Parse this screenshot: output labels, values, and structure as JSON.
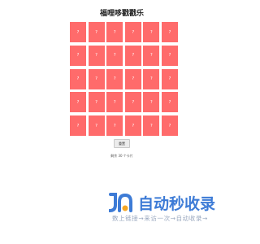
{
  "title": "福哩哆戳戳乐",
  "cards": [
    {
      "label": "?"
    },
    {
      "label": "?"
    },
    {
      "label": "?"
    },
    {
      "label": "?"
    },
    {
      "label": "?"
    },
    {
      "label": "?"
    },
    {
      "label": "?"
    },
    {
      "label": "?"
    },
    {
      "label": "?"
    },
    {
      "label": "?"
    },
    {
      "label": "?"
    },
    {
      "label": "?"
    },
    {
      "label": "?"
    },
    {
      "label": "?"
    },
    {
      "label": "?"
    },
    {
      "label": "?"
    },
    {
      "label": "?"
    },
    {
      "label": "?"
    },
    {
      "label": "?"
    },
    {
      "label": "?"
    },
    {
      "label": "?"
    },
    {
      "label": "?"
    },
    {
      "label": "?"
    },
    {
      "label": "?"
    },
    {
      "label": "?"
    },
    {
      "label": "?"
    },
    {
      "label": "?"
    },
    {
      "label": "?"
    },
    {
      "label": "?"
    },
    {
      "label": "?"
    }
  ],
  "reset_button": {
    "label": "重置"
  },
  "status": {
    "remaining_text": "剩余 30 个卡片"
  },
  "watermark": {
    "logo_text": "自动秒收录",
    "tagline": "数上链接→来访一次→自动收录→"
  },
  "colors": {
    "card_back": "#ff6b6b",
    "watermark_blue": "#3d7bd6",
    "watermark_orange": "#f5a623"
  }
}
